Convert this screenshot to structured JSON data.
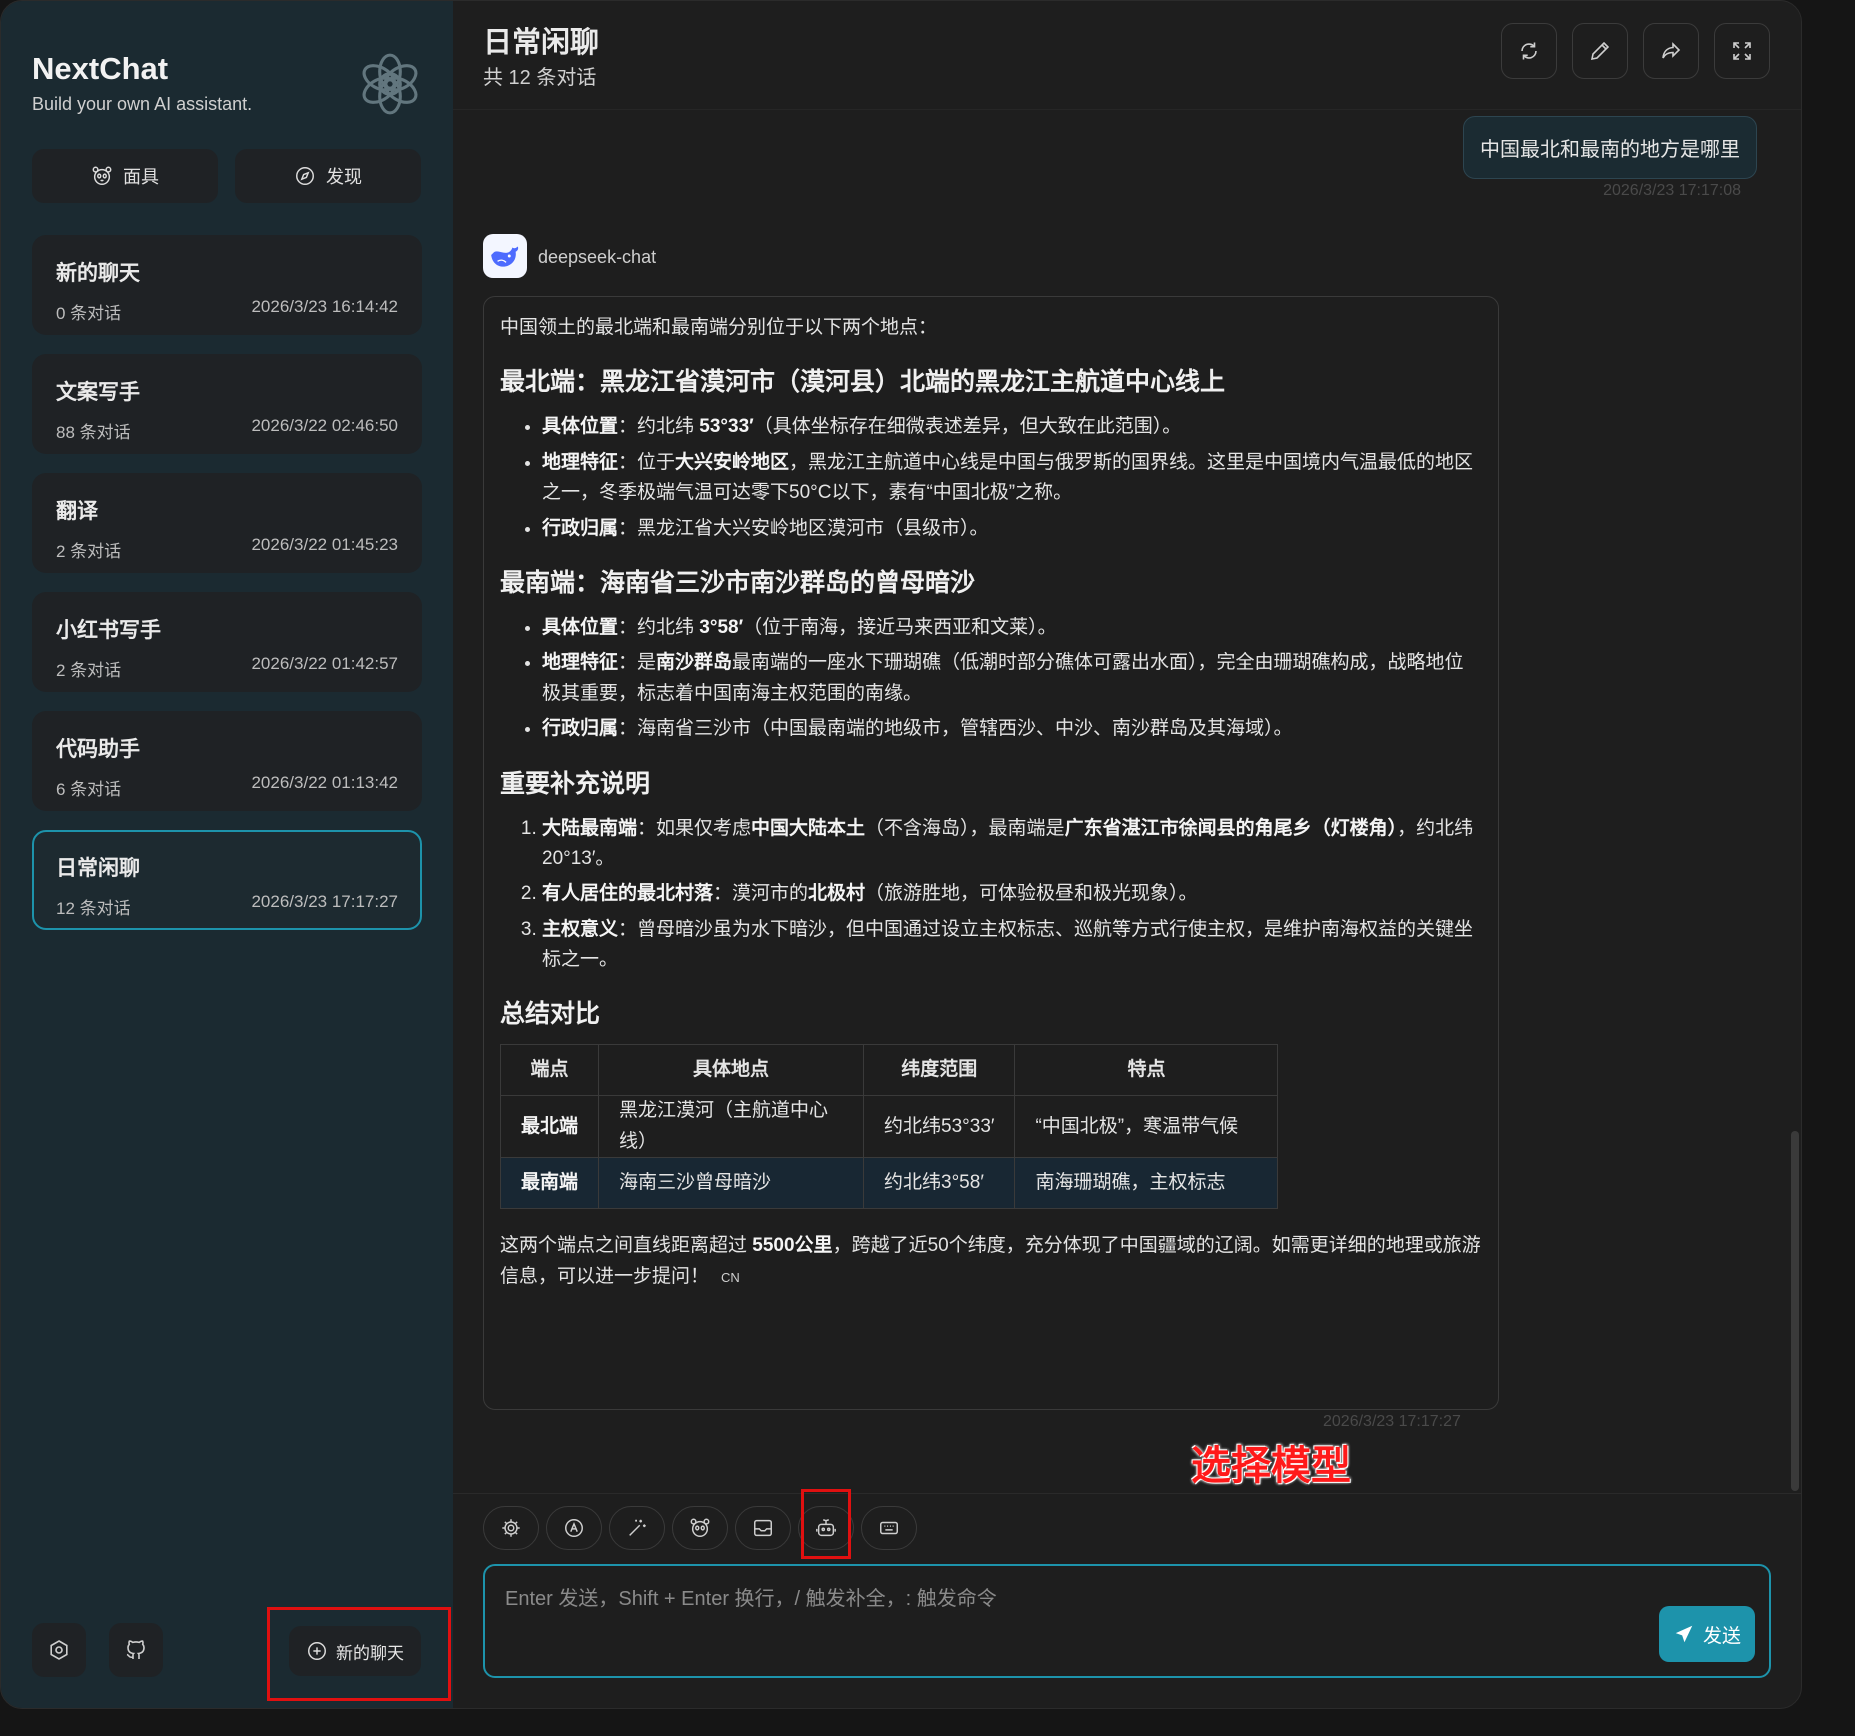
{
  "sidebar": {
    "title": "NextChat",
    "subtitle": "Build your own AI assistant.",
    "mask_label": "面具",
    "discover_label": "发现",
    "new_chat_label": "新的聊天",
    "chats": [
      {
        "title": "新的聊天",
        "count": "0 条对话",
        "time": "2026/3/23 16:14:42",
        "active": false
      },
      {
        "title": "文案写手",
        "count": "88 条对话",
        "time": "2026/3/22 02:46:50",
        "active": false
      },
      {
        "title": "翻译",
        "count": "2 条对话",
        "time": "2026/3/22 01:45:23",
        "active": false
      },
      {
        "title": "小红书写手",
        "count": "2 条对话",
        "time": "2026/3/22 01:42:57",
        "active": false
      },
      {
        "title": "代码助手",
        "count": "6 条对话",
        "time": "2026/3/22 01:13:42",
        "active": false
      },
      {
        "title": "日常闲聊",
        "count": "12 条对话",
        "time": "2026/3/23 17:17:27",
        "active": true
      }
    ]
  },
  "header": {
    "title": "日常闲聊",
    "subtitle": "共 12 条对话"
  },
  "messages": {
    "user_text": "中国最北和最南的地方是哪里",
    "user_time": "2026/3/23 17:17:08",
    "bot_name": "deepseek-chat",
    "bot_time": "2026/3/23 17:17:27",
    "intro": "中国领土的最北端和最南端分别位于以下两个地点：",
    "h_north": "最北端：黑龙江省漠河市（漠河县）北端的黑龙江主航道中心线上",
    "north_items": [
      {
        "k": "具体位置",
        "sep": "：约北纬 ",
        "b": "53°33′",
        "rest": "（具体坐标存在细微表述差异，但大致在此范围）。"
      },
      {
        "k": "地理特征",
        "sep": "：位于",
        "b": "大兴安岭地区",
        "rest": "，黑龙江主航道中心线是中国与俄罗斯的国界线。这里是中国境内气温最低的地区之一，冬季极端气温可达零下50°C以下，素有“中国北极”之称。"
      },
      {
        "k": "行政归属",
        "sep": "：黑龙江省大兴安岭地区漠河市（县级市）。",
        "b": "",
        "rest": ""
      }
    ],
    "h_south": "最南端：海南省三沙市南沙群岛的曾母暗沙",
    "south_items": [
      {
        "k": "具体位置",
        "sep": "：约北纬 ",
        "b": "3°58′",
        "rest": "（位于南海，接近马来西亚和文莱）。"
      },
      {
        "k": "地理特征",
        "sep": "：是",
        "b": "南沙群岛",
        "rest": "最南端的一座水下珊瑚礁（低潮时部分礁体可露出水面），完全由珊瑚礁构成，战略地位极其重要，标志着中国南海主权范围的南缘。"
      },
      {
        "k": "行政归属",
        "sep": "：海南省三沙市（中国最南端的地级市，管辖西沙、中沙、南沙群岛及其海域）。",
        "b": "",
        "rest": ""
      }
    ],
    "h_note": "重要补充说明",
    "note_items": [
      {
        "k": "大陆最南端",
        "sep": "：如果仅考虑",
        "b": "中国大陆本土",
        "mid": "（不含海岛），最南端是",
        "b2": "广东省湛江市徐闻县的角尾乡（灯楼角）",
        "rest": "，约北纬20°13′。"
      },
      {
        "k": "有人居住的最北村落",
        "sep": "：漠河市的",
        "b": "北极村",
        "mid": "（旅游胜地，可体验极昼和极光现象）。",
        "b2": "",
        "rest": ""
      },
      {
        "k": "主权意义",
        "sep": "：曾母暗沙虽为水下暗沙，但中国通过设立主权标志、巡航等方式行使主权，是维护南海权益的关键坐标之一。",
        "b": "",
        "mid": "",
        "b2": "",
        "rest": ""
      }
    ],
    "h_summary": "总结对比",
    "table": {
      "headers": [
        "端点",
        "具体地点",
        "纬度范围",
        "特点"
      ],
      "rows": [
        [
          "最北端",
          "黑龙江漠河（主航道中心线）",
          "约北纬53°33′",
          "“中国北极”，寒温带气候"
        ],
        [
          "最南端",
          "海南三沙曾母暗沙",
          "约北纬3°58′",
          "南海珊瑚礁，主权标志"
        ]
      ]
    },
    "final_pre": "这两个端点之间直线距离超过 ",
    "final_bold": "5500公里",
    "final_post": "，跨越了近50个纬度，充分体现了中国疆域的辽阔。如需更详细的地理或旅游信息，可以进一步提问！",
    "final_tag": "CN"
  },
  "annotation": {
    "label": "选择模型",
    "color": "#e01010"
  },
  "input": {
    "placeholder": "Enter 发送，Shift + Enter 换行，/ 触发补全，: 触发命令",
    "value": "",
    "send_label": "发送"
  },
  "colors": {
    "accent": "#1d93ab",
    "sidebar_bg": "#1b2a31",
    "main_bg": "#1e1e1e"
  }
}
